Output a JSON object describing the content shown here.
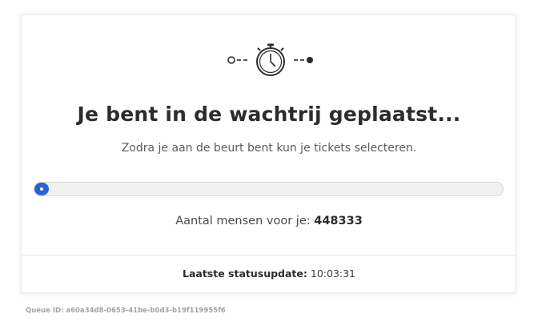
{
  "header": {
    "icon": "stopwatch-icon",
    "title": "Je bent in de wachtrij geplaatst...",
    "subtitle": "Zodra je aan de beurt bent kun je tickets selecteren."
  },
  "progress": {
    "value_percent": 0,
    "color": "#2f61d6"
  },
  "queue": {
    "people_label": "Aantal mensen voor je:",
    "people_count": "448333"
  },
  "status": {
    "label": "Laatste statusupdate:",
    "time": "10:03:31"
  },
  "footer": {
    "queue_id": "Queue ID: a60a34d8-0653-41be-b0d3-b19f119955f6"
  }
}
